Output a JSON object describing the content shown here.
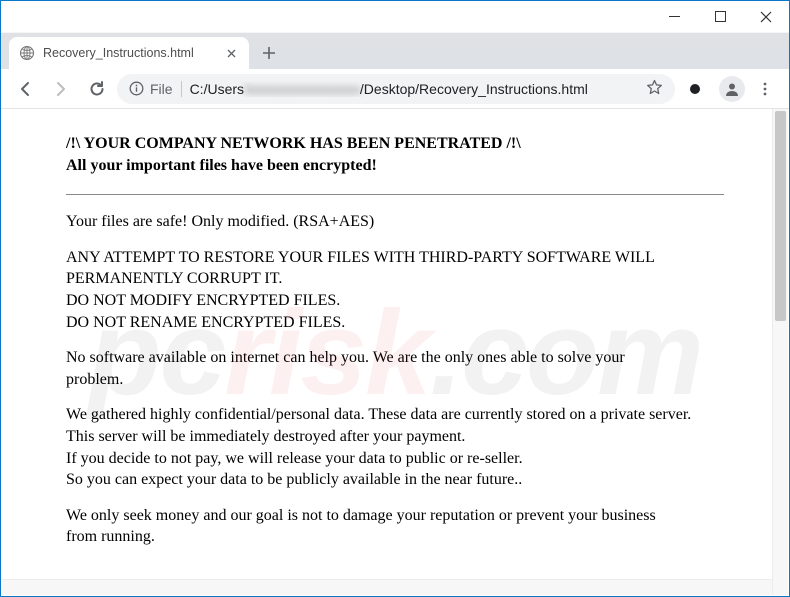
{
  "window": {
    "minimize_tip": "Minimize",
    "maximize_tip": "Maximize",
    "close_tip": "Close"
  },
  "tab": {
    "title": "Recovery_Instructions.html",
    "close_tip": "Close tab",
    "newtab_tip": "New tab"
  },
  "toolbar": {
    "back_tip": "Back",
    "forward_tip": "Forward",
    "reload_tip": "Reload",
    "file_label": "File",
    "path_prefix": "C:/Users",
    "path_suffix": "/Desktop/Recovery_Instructions.html",
    "star_tip": "Bookmark this tab",
    "account_tip": "You",
    "menu_tip": "Customize and control Google Chrome"
  },
  "page": {
    "headline1": "/!\\ YOUR COMPANY NETWORK HAS BEEN PENETRATED /!\\",
    "headline2": "All your important files have been encrypted!",
    "p1": "Your files are safe! Only modified. (RSA+AES)",
    "p2a": "ANY ATTEMPT TO RESTORE YOUR FILES WITH THIRD-PARTY SOFTWARE WILL PERMANENTLY CORRUPT IT.",
    "p2b": "DO NOT MODIFY ENCRYPTED FILES.",
    "p2c": "DO NOT RENAME ENCRYPTED FILES.",
    "p3": "No software available on internet can help you. We are the only ones able to solve your problem.",
    "p4a": "We gathered highly confidential/personal data. These data are currently stored on a private server. This server will be immediately destroyed after your payment.",
    "p4b": "If you decide to not pay, we will release your data to public or re-seller.",
    "p4c": "So you can expect your data to be publicly available in the near future..",
    "p5": "We only seek money and our goal is not to damage your reputation or prevent your business from running."
  },
  "watermark": {
    "left": "pc",
    "mid": "risk",
    "right": ".com"
  }
}
